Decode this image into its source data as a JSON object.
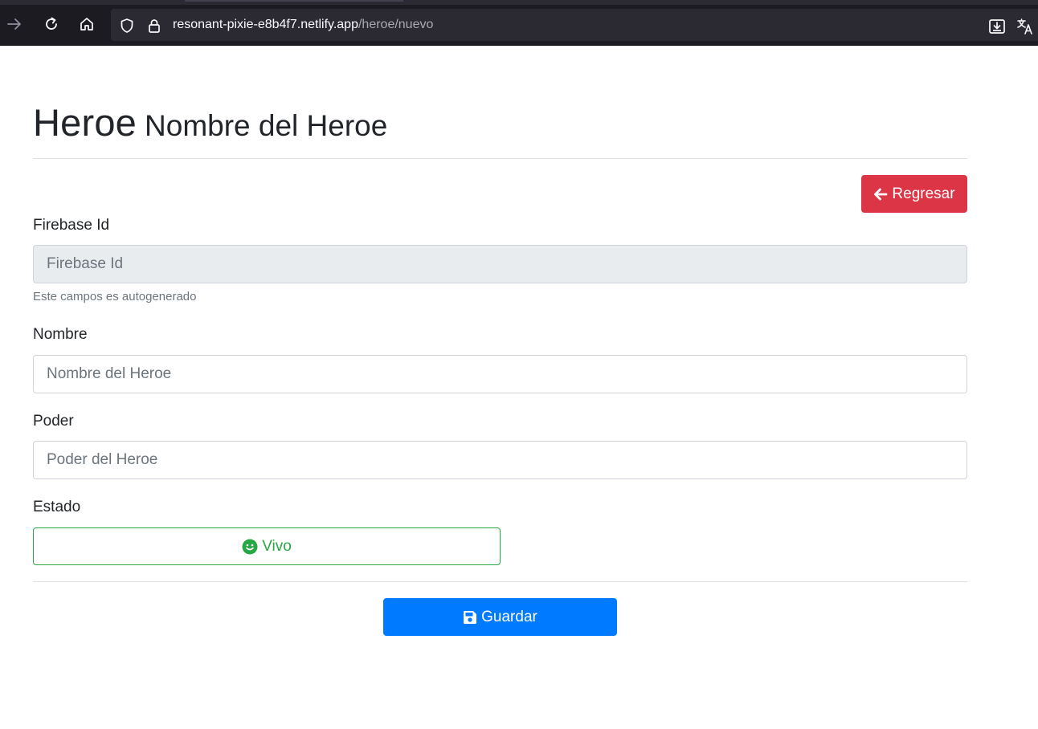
{
  "browser": {
    "url_host": "resonant-pixie-e8b4f7.netlify.app",
    "url_path": "/heroe/nuevo",
    "icons": [
      "forward-arrow-icon",
      "reload-icon",
      "home-icon",
      "shield-icon",
      "lock-icon",
      "download-icon",
      "translate-icon"
    ]
  },
  "header": {
    "title": "Heroe",
    "subtitle": "Nombre del Heroe"
  },
  "back_button": {
    "label": "Regresar",
    "icon": "arrow-left-icon",
    "color": "#dc3545"
  },
  "form": {
    "firebase_id": {
      "label": "Firebase Id",
      "placeholder": "Firebase Id",
      "help": "Este campos es autogenerado"
    },
    "nombre": {
      "label": "Nombre",
      "placeholder": "Nombre del Heroe"
    },
    "poder": {
      "label": "Poder",
      "placeholder": "Poder del Heroe"
    },
    "estado": {
      "label": "Estado",
      "button_label": "Vivo",
      "icon": "smile-icon",
      "color": "#28a745"
    }
  },
  "save_button": {
    "label": "Guardar",
    "icon": "floppy-disk-icon",
    "color": "#007bff"
  }
}
